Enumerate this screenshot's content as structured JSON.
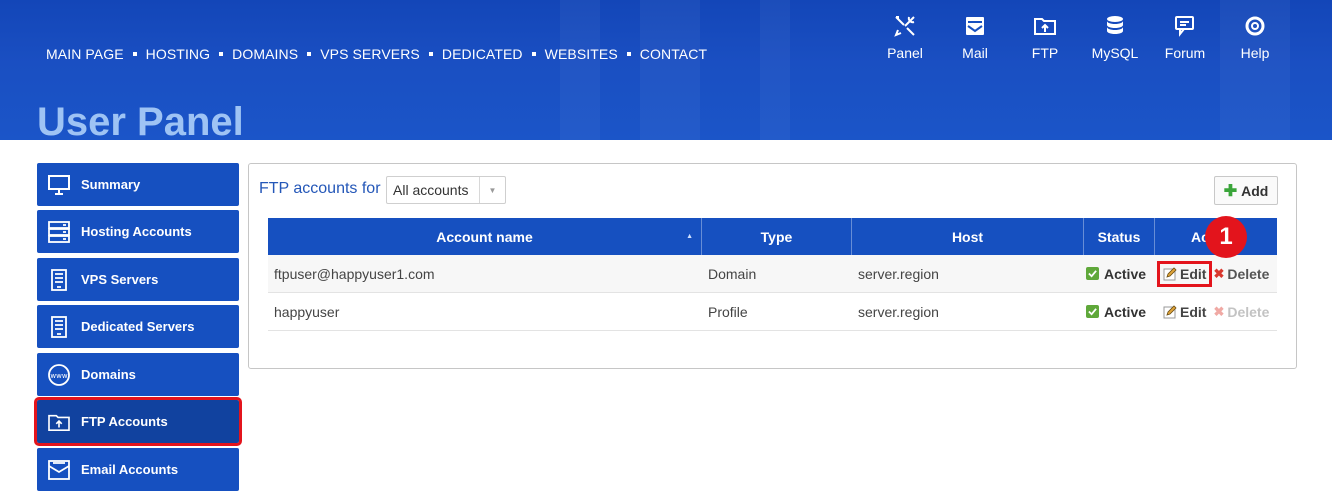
{
  "nav": {
    "items": [
      "MAIN PAGE",
      "HOSTING",
      "DOMAINS",
      "VPS SERVERS",
      "DEDICATED",
      "WEBSITES",
      "CONTACT"
    ]
  },
  "tools": [
    {
      "label": "Panel",
      "icon": "tools-icon"
    },
    {
      "label": "Mail",
      "icon": "mail-icon"
    },
    {
      "label": "FTP",
      "icon": "ftp-folder-icon"
    },
    {
      "label": "MySQL",
      "icon": "database-icon"
    },
    {
      "label": "Forum",
      "icon": "forum-icon"
    },
    {
      "label": "Help",
      "icon": "lifebuoy-icon"
    }
  ],
  "page_title": "User Panel",
  "sidebar": {
    "items": [
      {
        "label": "Summary",
        "icon": "monitor-icon"
      },
      {
        "label": "Hosting Accounts",
        "icon": "server-rack-icon"
      },
      {
        "label": "VPS Servers",
        "icon": "vps-icon"
      },
      {
        "label": "Dedicated Servers",
        "icon": "dedicated-server-icon"
      },
      {
        "label": "Domains",
        "icon": "www-globe-icon"
      },
      {
        "label": "FTP Accounts",
        "icon": "ftp-folder-icon",
        "active": true
      },
      {
        "label": "Email Accounts",
        "icon": "email-icon"
      }
    ]
  },
  "main": {
    "filter_label": "FTP accounts for",
    "filter_value": "All accounts",
    "add_label": "Add",
    "table": {
      "headers": [
        "Account name",
        "Type",
        "Host",
        "Status",
        "Actions"
      ],
      "header_actions_visible": "Ac",
      "rows": [
        {
          "account": "ftpuser@happyuser1.com",
          "type": "Domain",
          "host": "server.region",
          "status": "Active",
          "edit": "Edit",
          "delete": "Delete"
        },
        {
          "account": "happyuser",
          "type": "Profile",
          "host": "server.region",
          "status": "Active",
          "edit": "Edit",
          "delete": "Delete"
        }
      ]
    }
  },
  "callout_number": "1",
  "colors": {
    "header_blue": "#1650c0",
    "highlight_red": "#e3141c",
    "status_green": "#5fa83a",
    "title_light_blue": "#9ec3f4"
  }
}
